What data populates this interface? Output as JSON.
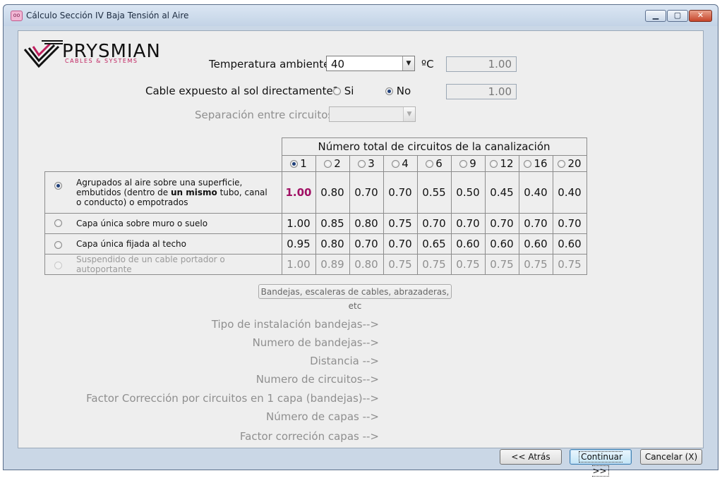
{
  "window": {
    "title": "Cálculo Sección IV Baja Tensión al Aire",
    "icon": "app-icon",
    "controls": {
      "minimize": "▭",
      "maximize": "▢",
      "close": "✕"
    }
  },
  "logo": {
    "brand": "PRYSMIAN",
    "subtitle": "CABLES & SYSTEMS",
    "accent_color": "#c0205f"
  },
  "temperature": {
    "label": "Temperatura ambiente",
    "value": "40",
    "unit": "ºC",
    "factor": "1.00"
  },
  "sun": {
    "label": "Cable expuesto al sol directamente?",
    "option_yes": "Si",
    "option_no": "No",
    "selected": "No",
    "factor": "1.00"
  },
  "separation": {
    "label": "Separación entre circuitos",
    "value": "",
    "enabled": false
  },
  "circuits_table": {
    "title": "Número total de circuitos de la canalización",
    "columns": [
      "1",
      "2",
      "3",
      "4",
      "6",
      "9",
      "12",
      "16",
      "20"
    ],
    "selected_column": "1",
    "rows": [
      {
        "label_parts": [
          "Agrupados al aire sobre una superficie,",
          "embutidos (dentro de ",
          "un mismo",
          " tubo, canal",
          "o conducto) o empotrados"
        ],
        "values": [
          "1.00",
          "0.80",
          "0.70",
          "0.70",
          "0.55",
          "0.50",
          "0.45",
          "0.40",
          "0.40"
        ],
        "selected": true,
        "enabled": true
      },
      {
        "label": "Capa única sobre muro o suelo",
        "values": [
          "1.00",
          "0.85",
          "0.80",
          "0.75",
          "0.70",
          "0.70",
          "0.70",
          "0.70",
          "0.70"
        ],
        "selected": false,
        "enabled": true
      },
      {
        "label": "Capa única fijada al techo",
        "values": [
          "0.95",
          "0.80",
          "0.70",
          "0.70",
          "0.65",
          "0.60",
          "0.60",
          "0.60",
          "0.60"
        ],
        "selected": false,
        "enabled": true
      },
      {
        "label": "Suspendido de un cable portador o autoportante",
        "values": [
          "1.00",
          "0.89",
          "0.80",
          "0.75",
          "0.75",
          "0.75",
          "0.75",
          "0.75",
          "0.75"
        ],
        "selected": false,
        "enabled": false
      }
    ],
    "highlight_color": "#a01064"
  },
  "trays_button": "Bandejas, escaleras de cables, abrazaderas, etc",
  "tray_info": [
    "Tipo de instalación bandejas-->",
    "Numero de bandejas-->",
    "Distancia  -->",
    "Numero de circuitos-->",
    "Factor Corrección por circuitos en 1 capa (bandejas)-->",
    "Número de capas -->",
    "Factor correción capas  -->"
  ],
  "footer": {
    "back": "<< Atrás",
    "continue": "Continuar >>",
    "cancel": "Cancelar (X)"
  }
}
